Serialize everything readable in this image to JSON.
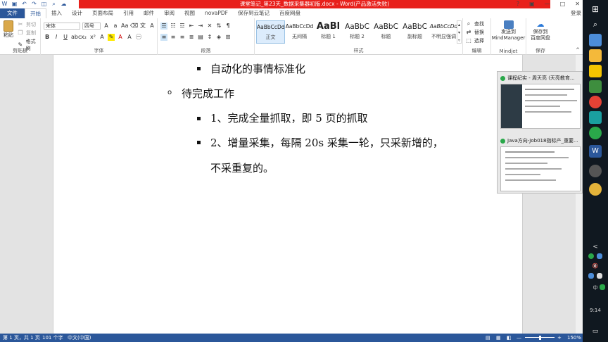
{
  "window": {
    "title": "课堂笔记_第23天_数据采集器初版.docx - Word(产品激活失败)",
    "login": "登录",
    "controls": [
      "?",
      "▣",
      "—",
      "□",
      "✕"
    ]
  },
  "tabs": [
    {
      "label": "文件"
    },
    {
      "label": "开始"
    },
    {
      "label": "插入"
    },
    {
      "label": "设计"
    },
    {
      "label": "页面布局"
    },
    {
      "label": "引用"
    },
    {
      "label": "邮件"
    },
    {
      "label": "审阅"
    },
    {
      "label": "视图"
    },
    {
      "label": "novaPDF"
    },
    {
      "label": "保存到云笔记"
    },
    {
      "label": "百度网盘"
    }
  ],
  "ribbon": {
    "clipboard": {
      "paste": "粘贴",
      "cut": "剪切",
      "copy": "复制",
      "format_painter": "格式刷",
      "label": "剪贴板"
    },
    "font": {
      "name": "宋体",
      "size": "四号",
      "label": "字体"
    },
    "paragraph": {
      "label": "段落"
    },
    "styles": {
      "label": "样式",
      "items": [
        {
          "sample": "AaBbCcDd",
          "name": "正文"
        },
        {
          "sample": "AaBbCcDd",
          "name": "无间隔"
        },
        {
          "sample": "AaBl",
          "name": "标题 1"
        },
        {
          "sample": "AaBbC",
          "name": "标题 2"
        },
        {
          "sample": "AaBbC",
          "name": "标题"
        },
        {
          "sample": "AaBbC",
          "name": "副标题"
        },
        {
          "sample": "AaBbCcDd",
          "name": "不明显强调"
        }
      ]
    },
    "editing": {
      "find": "查找",
      "replace": "替换",
      "select": "选择",
      "label": "编辑"
    },
    "mindjet": {
      "send": "发送到",
      "target": "MindManager",
      "label": "Mindjet"
    },
    "save": {
      "line1": "保存到",
      "line2": "百度网盘",
      "label": "保存"
    }
  },
  "document": {
    "lines": [
      {
        "text": "自动化的事情标准化"
      },
      {
        "text": "待完成工作"
      },
      {
        "text": "1、完成全量抓取，即 5 页的抓取"
      },
      {
        "text": "2、增量采集，每隔 20s 采集一轮，只采新增的，"
      },
      {
        "text": "不采重复的。"
      }
    ]
  },
  "status": {
    "page": "第 1 页，共 1 页",
    "words": "101 个字",
    "lang": "中文(中国)",
    "zoom": "150%",
    "zoom_minus": "—",
    "zoom_plus": "+"
  },
  "thumbnails": [
    {
      "title": "课程纪实 - 周天亮 (天亮教育..."
    },
    {
      "title": "Java方向-Job018指标产_重要..."
    }
  ],
  "taskbar": {
    "time": "9:14",
    "ime": "中",
    "expand": "<",
    "vol_icon": "volume-mute-icon"
  }
}
